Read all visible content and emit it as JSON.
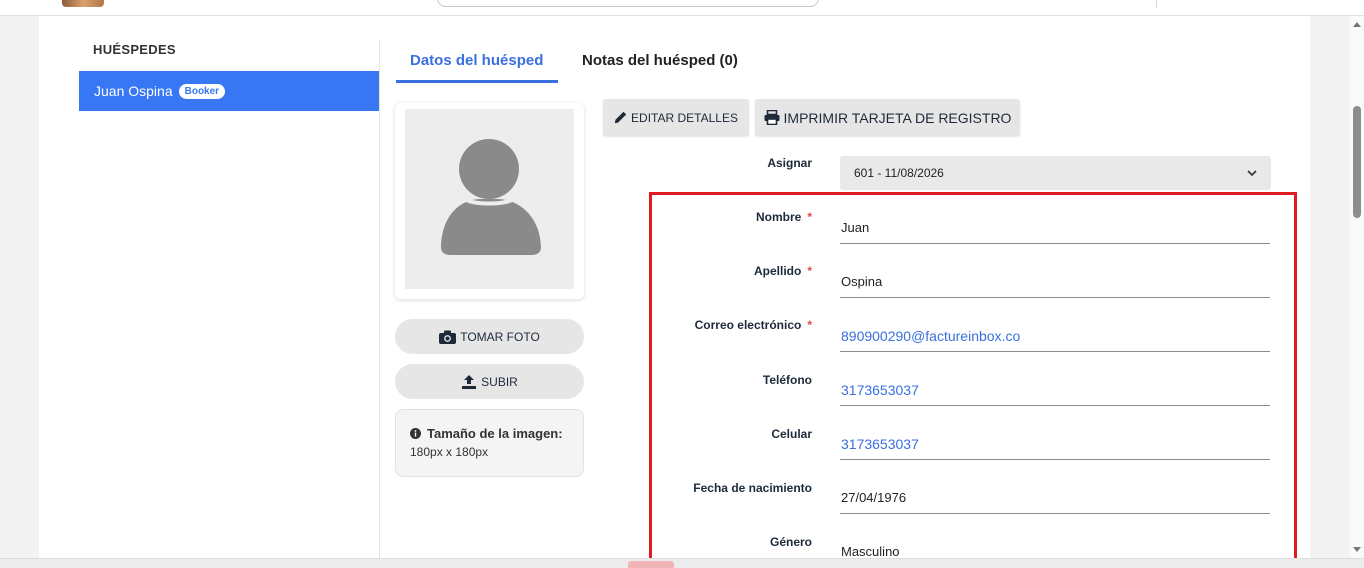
{
  "guests": {
    "title": "HUÉSPEDES",
    "items": [
      {
        "name": "Juan Ospina",
        "badge": "Booker"
      }
    ]
  },
  "tabs": [
    {
      "label": "Datos del huésped",
      "active": true
    },
    {
      "label": "Notas del huésped (0)",
      "active": false
    }
  ],
  "actions": {
    "edit_label": "EDITAR DETALLES",
    "print_label": "IMPRIMIR TARJETA DE REGISTRO"
  },
  "photo": {
    "take_label": "TOMAR FOTO",
    "upload_label": "SUBIR",
    "size_title": "Tamaño de la imagen:",
    "size_value": "180px x 180px"
  },
  "form": {
    "assign": {
      "label": "Asignar",
      "value": "601 - 11/08/2026"
    },
    "nombre": {
      "label": "Nombre",
      "value": "Juan",
      "required": "*"
    },
    "apellido": {
      "label": "Apellido",
      "value": "Ospina",
      "required": "*"
    },
    "correo": {
      "label": "Correo electrónico",
      "value": "890900290@factureinbox.co",
      "required": "*"
    },
    "telefono": {
      "label": "Teléfono",
      "value": "3173653037"
    },
    "celular": {
      "label": "Celular",
      "value": "3173653037"
    },
    "nacimiento": {
      "label": "Fecha de nacimiento",
      "value": "27/04/1976"
    },
    "genero": {
      "label": "Género",
      "value": "Masculino"
    }
  },
  "colors": {
    "accent": "#3877f4",
    "link": "#3a6fe0",
    "required": "#e24848",
    "highlight": "#e01b24"
  }
}
